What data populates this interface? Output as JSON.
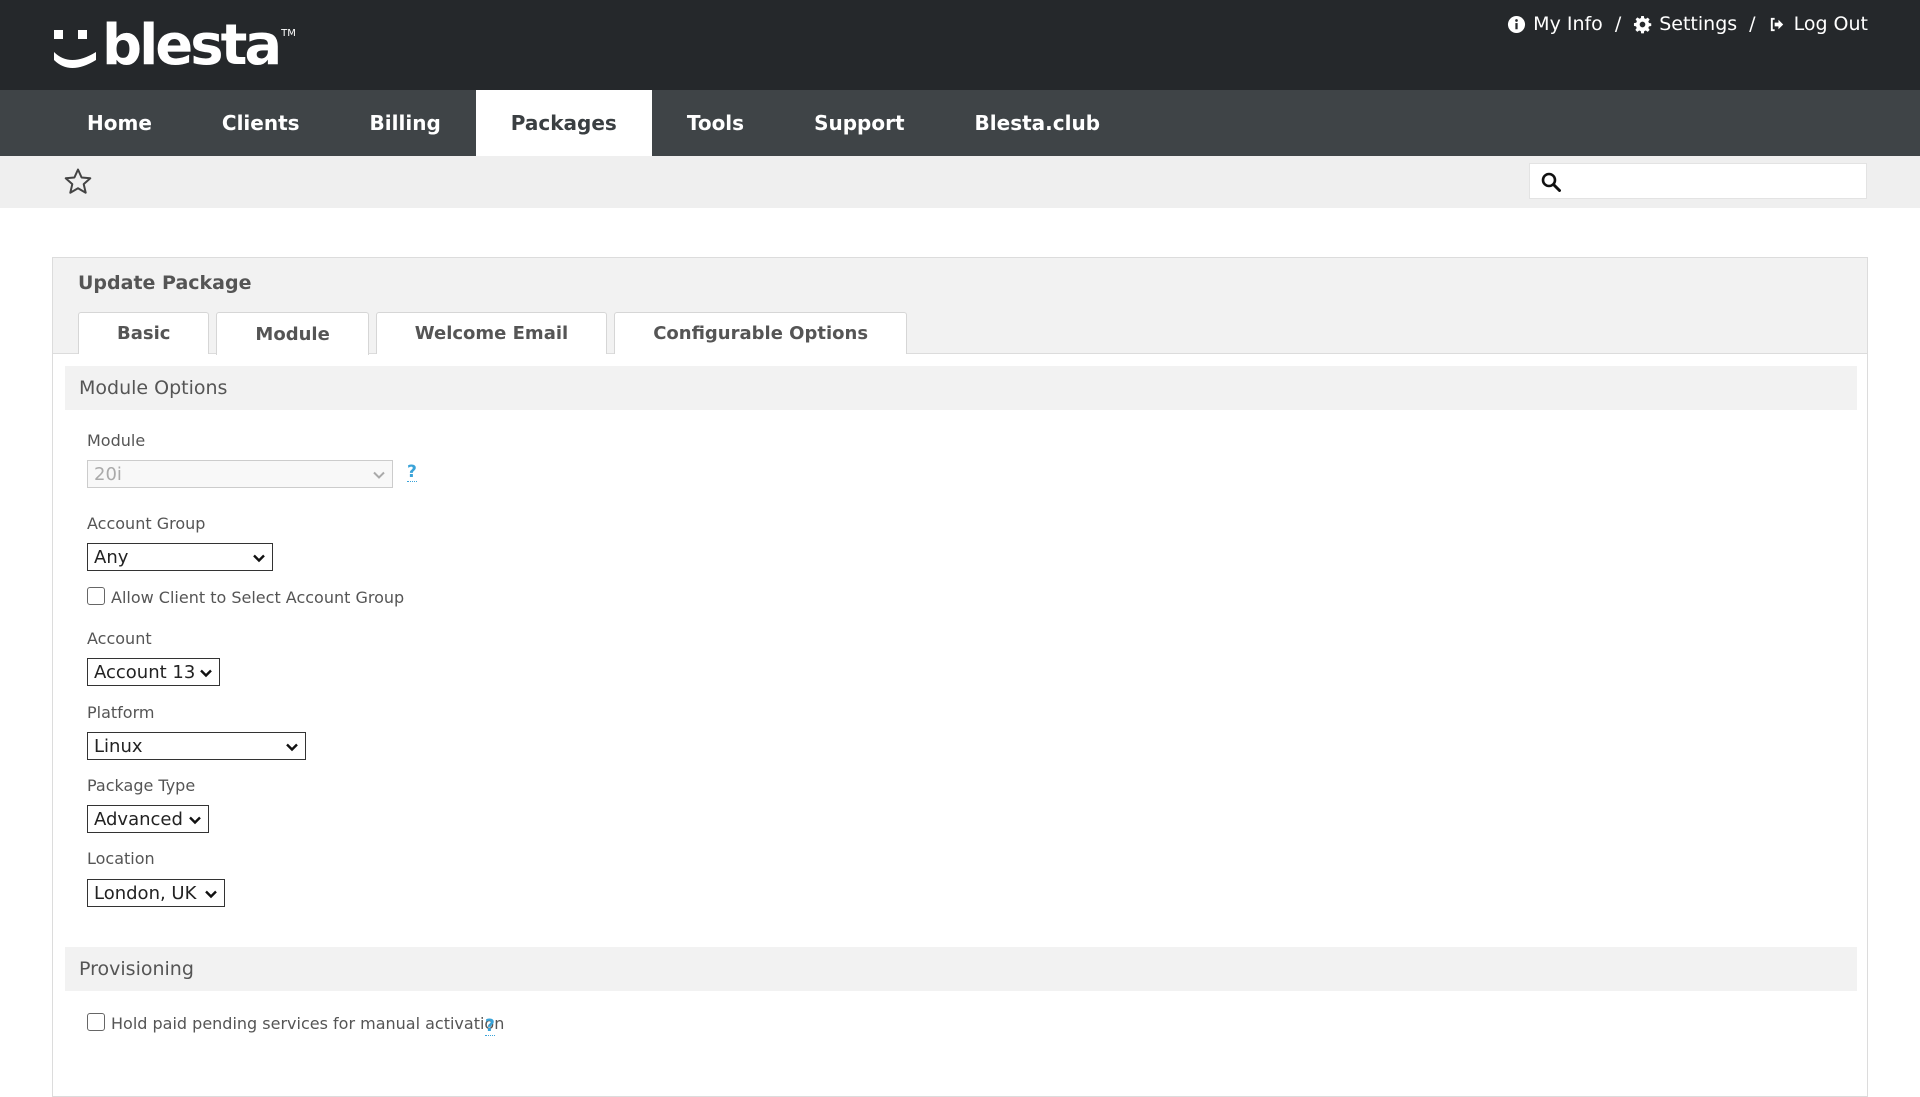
{
  "brand": {
    "logo_text": "blesta",
    "tm": "TM"
  },
  "toplinks": [
    {
      "label": "My Info",
      "icon": "info-icon"
    },
    {
      "label": "Settings",
      "icon": "gear-icon"
    },
    {
      "label": "Log Out",
      "icon": "logout-icon"
    }
  ],
  "toplink_separator": "/",
  "nav": [
    "Home",
    "Clients",
    "Billing",
    "Packages",
    "Tools",
    "Support",
    "Blesta.club"
  ],
  "nav_active": "Packages",
  "search": {
    "placeholder": ""
  },
  "panel": {
    "title": "Update Package",
    "tabs": [
      "Basic",
      "Module",
      "Welcome Email",
      "Configurable Options"
    ],
    "active_tab": "Module"
  },
  "module_options": {
    "heading": "Module Options",
    "module_label": "Module",
    "module_value": "20i",
    "help_mark": "?",
    "account_group_label": "Account Group",
    "account_group_value": "Any",
    "allow_select_label": "Allow Client to Select Account Group",
    "account_label": "Account",
    "account_value": "Account 13",
    "platform_label": "Platform",
    "platform_value": "Linux",
    "package_type_label": "Package Type",
    "package_type_value": "Advanced",
    "location_label": "Location",
    "location_value": "London, UK"
  },
  "provisioning": {
    "heading": "Provisioning",
    "hold_label": "Hold paid pending services for manual activation",
    "help_mark": "?"
  },
  "colors": {
    "header_bg": "#25282b",
    "nav_bg": "#3f4447",
    "accent_help": "#3aa3d8"
  }
}
